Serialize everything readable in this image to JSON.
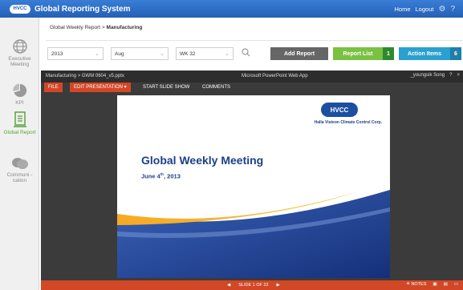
{
  "app": {
    "logo_text": "HVCC",
    "title": "Global Reporting System",
    "links": [
      "Home",
      "Logout"
    ]
  },
  "sidebar": {
    "items": [
      {
        "label": "Executive Meeting",
        "icon": "globe-icon"
      },
      {
        "label": "KPI",
        "icon": "pie-chart-icon"
      },
      {
        "label": "Global Report",
        "icon": "report-icon",
        "active": true
      },
      {
        "label": "Communi -cation",
        "icon": "chat-bubbles-icon"
      }
    ]
  },
  "breadcrumb": {
    "parent": "Global Weekly Report",
    "separator": ">",
    "current": "Manufacturing"
  },
  "filters": {
    "year": "2013",
    "month": "Aug",
    "week": "WK 32"
  },
  "actions": {
    "add_report": "Add Report",
    "report_list": "Report List",
    "report_count": "1",
    "action_items": "Action Items",
    "action_count": "6"
  },
  "viewer": {
    "file_path": "Manufacturing > GWM 0604_v5.pptx",
    "app_name": "Microsoft PowerPoint Web App",
    "user": "_youngsik Song",
    "help": "?",
    "close": "×",
    "tabs": [
      "FILE",
      "EDIT PRESENTATION ▾",
      "START SLIDE SHOW",
      "COMMENTS"
    ]
  },
  "slide": {
    "logo": "HVCC",
    "company": "Halla Visteon Climate Control Corp.",
    "title": "Global Weekly Meeting",
    "date_prefix": "June 4",
    "date_sup": "th",
    "date_suffix": ", 2013"
  },
  "status": {
    "slide_counter": "SLIDE 1 OF 22",
    "notes": "NOTES"
  },
  "colors": {
    "top_bar": "#2b6cc4",
    "ppt_accent": "#d24726",
    "green": "#7ac142",
    "blue_button": "#2aa0d0",
    "slide_navy": "#1c3f8a"
  }
}
